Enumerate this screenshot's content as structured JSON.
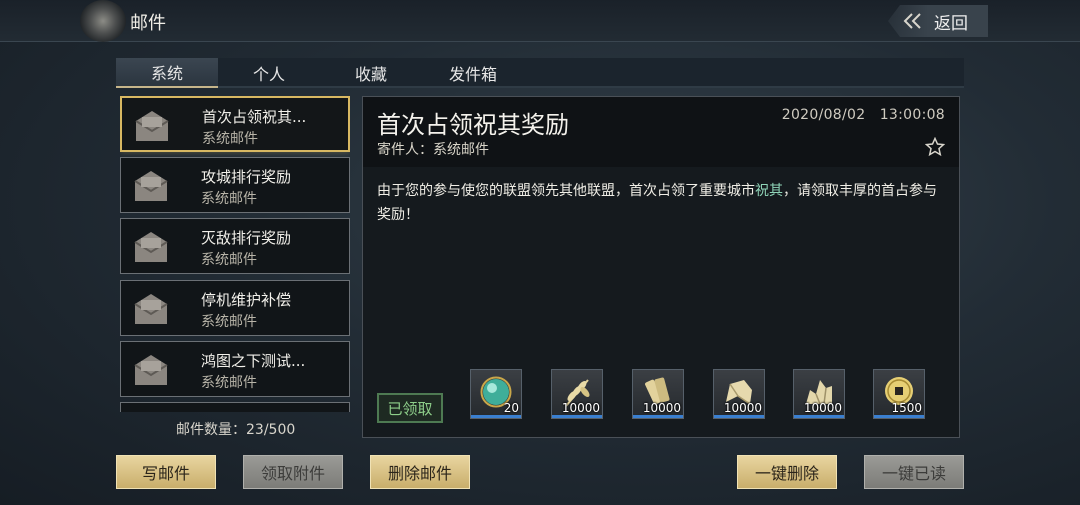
{
  "header": {
    "title": "邮件",
    "back_label": "返回"
  },
  "tabs": [
    {
      "label": "系统",
      "active": true
    },
    {
      "label": "个人",
      "active": false
    },
    {
      "label": "收藏",
      "active": false
    },
    {
      "label": "发件箱",
      "active": false
    }
  ],
  "mail_list": {
    "items": [
      {
        "title": "首次占领祝其...",
        "sender": "系统邮件",
        "selected": true
      },
      {
        "title": "攻城排行奖励",
        "sender": "系统邮件",
        "selected": false
      },
      {
        "title": "灭敌排行奖励",
        "sender": "系统邮件",
        "selected": false
      },
      {
        "title": "停机维护补偿",
        "sender": "系统邮件",
        "selected": false
      },
      {
        "title": "鸿图之下测试...",
        "sender": "系统邮件",
        "selected": false
      }
    ],
    "count_label": "邮件数量：23/500"
  },
  "detail": {
    "title": "首次占领祝其奖励",
    "sender_label": "寄件人：系统邮件",
    "date": "2020/08/02",
    "time": "13:00:08",
    "body_before": "由于您的参与使您的联盟领先其他联盟，首次占领了重要城市",
    "body_highlight": "祝其",
    "body_after": "，请领取丰厚的首占参与奖励！",
    "claimed_label": "已领取",
    "rewards": [
      {
        "icon": "jade-orb-icon",
        "qty": "20"
      },
      {
        "icon": "wheat-icon",
        "qty": "10000"
      },
      {
        "icon": "wood-log-icon",
        "qty": "10000"
      },
      {
        "icon": "stone-block-icon",
        "qty": "10000"
      },
      {
        "icon": "iron-ore-icon",
        "qty": "10000"
      },
      {
        "icon": "copper-coin-icon",
        "qty": "1500"
      }
    ]
  },
  "buttons": {
    "write": "写邮件",
    "claim_attachment": "领取附件",
    "delete": "删除邮件",
    "delete_all": "一键删除",
    "read_all": "一键已读"
  },
  "colors": {
    "accent_gold": "#d8b862",
    "highlight_text": "#8fd4b8",
    "claimed_green": "#8ecf8a"
  }
}
